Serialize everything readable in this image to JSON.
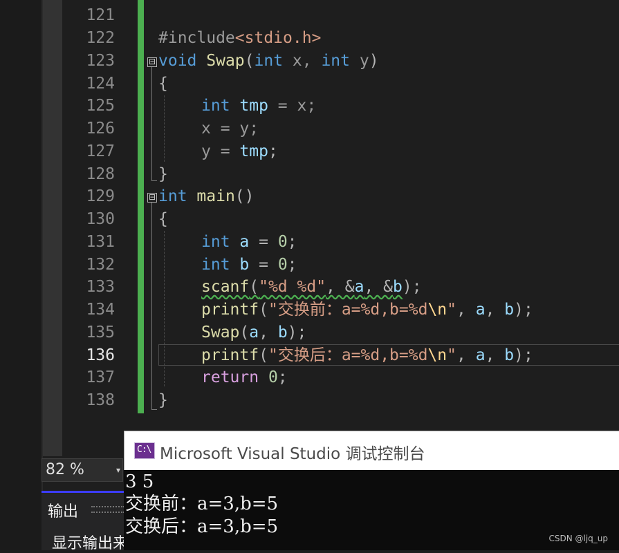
{
  "editor": {
    "line_numbers": [
      "121",
      "122",
      "123",
      "124",
      "125",
      "126",
      "127",
      "128",
      "129",
      "130",
      "131",
      "132",
      "133",
      "134",
      "135",
      "136",
      "137",
      "138"
    ],
    "current_line": "136",
    "code": {
      "l122_hash": "#include",
      "l122_header": "<stdio.h>",
      "l123_void": "void",
      "l123_name": "Swap",
      "l123_open": "(",
      "l123_int1": "int",
      "l123_x": " x, ",
      "l123_int2": "int",
      "l123_y": " y",
      "l123_close": ")",
      "l124": "{",
      "l125_int": "int",
      "l125_tmp": "tmp",
      "l125_rest": " = x;",
      "l126": "x = y;",
      "l127_y": "y = ",
      "l127_tmp": "tmp",
      "l127_semi": ";",
      "l128": "}",
      "l129_int": "int",
      "l129_main": "main",
      "l129_paren": "()",
      "l130": "{",
      "l131_int": "int",
      "l131_a": "a",
      "l131_eq": " = ",
      "l131_zero": "0",
      "l131_semi": ";",
      "l132_int": "int",
      "l132_b": "b",
      "l132_eq": " = ",
      "l132_zero": "0",
      "l132_semi": ";",
      "l133_fn": "scanf",
      "l133_open": "(",
      "l133_str": "\"%d %d\"",
      "l133_c1": ", &",
      "l133_a": "a",
      "l133_c2": ", &",
      "l133_b": "b",
      "l133_end": ");",
      "l134_fn": "printf",
      "l134_open": "(",
      "l134_str_a": "\"",
      "l134_cjk": "交换前：",
      "l134_str_b": "a=%d,b=%d",
      "l134_esc": "\\n",
      "l134_str_c": "\"",
      "l134_c1": ", ",
      "l134_a": "a",
      "l134_c2": ", ",
      "l134_b": "b",
      "l134_end": ");",
      "l135_fn": "Swap",
      "l135_open": "(",
      "l135_a": "a",
      "l135_c": ", ",
      "l135_b": "b",
      "l135_end": ");",
      "l136_fn": "printf",
      "l136_open": "(",
      "l136_str_a": "\"",
      "l136_cjk": "交换后：",
      "l136_str_b": "a=%d,b=%d",
      "l136_esc": "\\n",
      "l136_str_c": "\"",
      "l136_c1": ", ",
      "l136_a": "a",
      "l136_c2": ", ",
      "l136_b": "b",
      "l136_end": ");",
      "l137_ret": "return",
      "l137_zero": " 0",
      "l137_semi": ";",
      "l138": "}"
    },
    "fold_glyph": "⊟"
  },
  "zoom": {
    "label": "82 %",
    "caret": "▾"
  },
  "output_panel": {
    "tab_label": "输出",
    "show_output_label": "显示输出来"
  },
  "console": {
    "title": "Microsoft Visual Studio 调试控制台",
    "icon_glyph": "C:\\",
    "lines": [
      "3 5",
      "交换前：a=3,b=5",
      "交换后：a=3,b=5"
    ]
  },
  "watermark": "CSDN @ljq_up",
  "colors": {
    "background": "#1e1e1e",
    "change_bar": "#4caf50",
    "keyword": "#569cd6",
    "function": "#dcdcaa",
    "variable": "#9cdcfe",
    "string": "#d69d85",
    "number": "#b5cea8",
    "return_keyword": "#d8a0df",
    "console_bg": "#0c0c0c"
  }
}
